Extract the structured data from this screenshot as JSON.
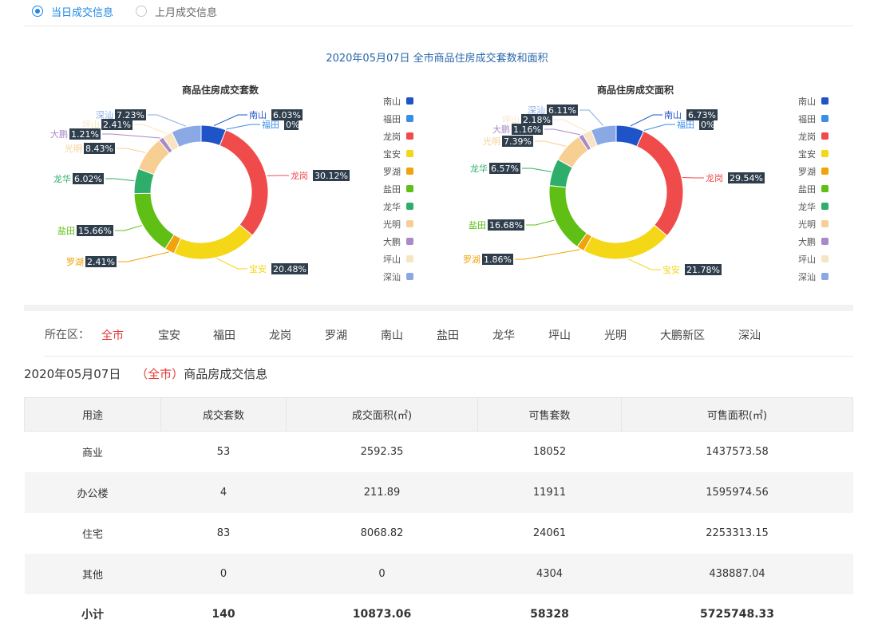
{
  "radios": [
    {
      "label": "当日成交信息",
      "selected": true
    },
    {
      "label": "上月成交信息",
      "selected": false
    }
  ],
  "charts_title": "2020年05月07日 全市商品住房成交套数和面积",
  "colors": {
    "南山": "#1f53c8",
    "福田": "#3a8ee6",
    "龙岗": "#f04b4b",
    "宝安": "#f4d716",
    "罗湖": "#f0a30a",
    "盐田": "#5fbf14",
    "龙华": "#2fae6b",
    "光明": "#f7cf93",
    "大鹏": "#a98ac9",
    "坪山": "#f7e4c4",
    "深汕": "#8aa9e4"
  },
  "chart_data": [
    {
      "type": "pie",
      "title": "商品住房成交套数",
      "legend_position": "right",
      "categories": [
        "南山",
        "福田",
        "龙岗",
        "宝安",
        "罗湖",
        "盐田",
        "龙华",
        "光明",
        "大鹏",
        "坪山",
        "深汕"
      ],
      "values": [
        6.03,
        0,
        30.12,
        20.48,
        2.41,
        15.66,
        6.02,
        8.43,
        1.21,
        2.41,
        7.23
      ],
      "labels": [
        "6.03%",
        "0%",
        "30.12%",
        "20.48%",
        "2.41%",
        "15.66%",
        "6.02%",
        "8.43%",
        "1.21%",
        "2.41%",
        "7.23%"
      ]
    },
    {
      "type": "pie",
      "title": "商品住房成交面积",
      "legend_position": "right",
      "categories": [
        "南山",
        "福田",
        "龙岗",
        "宝安",
        "罗湖",
        "盐田",
        "龙华",
        "光明",
        "大鹏",
        "坪山",
        "深汕"
      ],
      "values": [
        6.73,
        0,
        29.54,
        21.78,
        1.86,
        16.68,
        6.57,
        7.39,
        1.16,
        2.18,
        6.11
      ],
      "labels": [
        "6.73%",
        "0%",
        "29.54%",
        "21.78%",
        "1.86%",
        "16.68%",
        "6.57%",
        "7.39%",
        "1.16%",
        "2.18%",
        "6.11%"
      ]
    }
  ],
  "district": {
    "prefix": "所在区：",
    "items": [
      "全市",
      "宝安",
      "福田",
      "龙岗",
      "罗湖",
      "南山",
      "盐田",
      "龙华",
      "坪山",
      "光明",
      "大鹏新区",
      "深汕"
    ],
    "selected": "全市"
  },
  "section": {
    "date": "2020年05月07日",
    "open": "（",
    "area": "全市",
    "close": "）",
    "suffix": "商品房成交信息"
  },
  "table": {
    "headers": [
      "用途",
      "成交套数",
      "成交面积(㎡)",
      "可售套数",
      "可售面积(㎡)"
    ],
    "rows": [
      [
        "商业",
        "53",
        "2592.35",
        "18052",
        "1437573.58"
      ],
      [
        "办公楼",
        "4",
        "211.89",
        "11911",
        "1595974.56"
      ],
      [
        "住宅",
        "83",
        "8068.82",
        "24061",
        "2253313.15"
      ],
      [
        "其他",
        "0",
        "0",
        "4304",
        "438887.04"
      ]
    ],
    "total": [
      "小计",
      "140",
      "10873.06",
      "58328",
      "5725748.33"
    ]
  }
}
